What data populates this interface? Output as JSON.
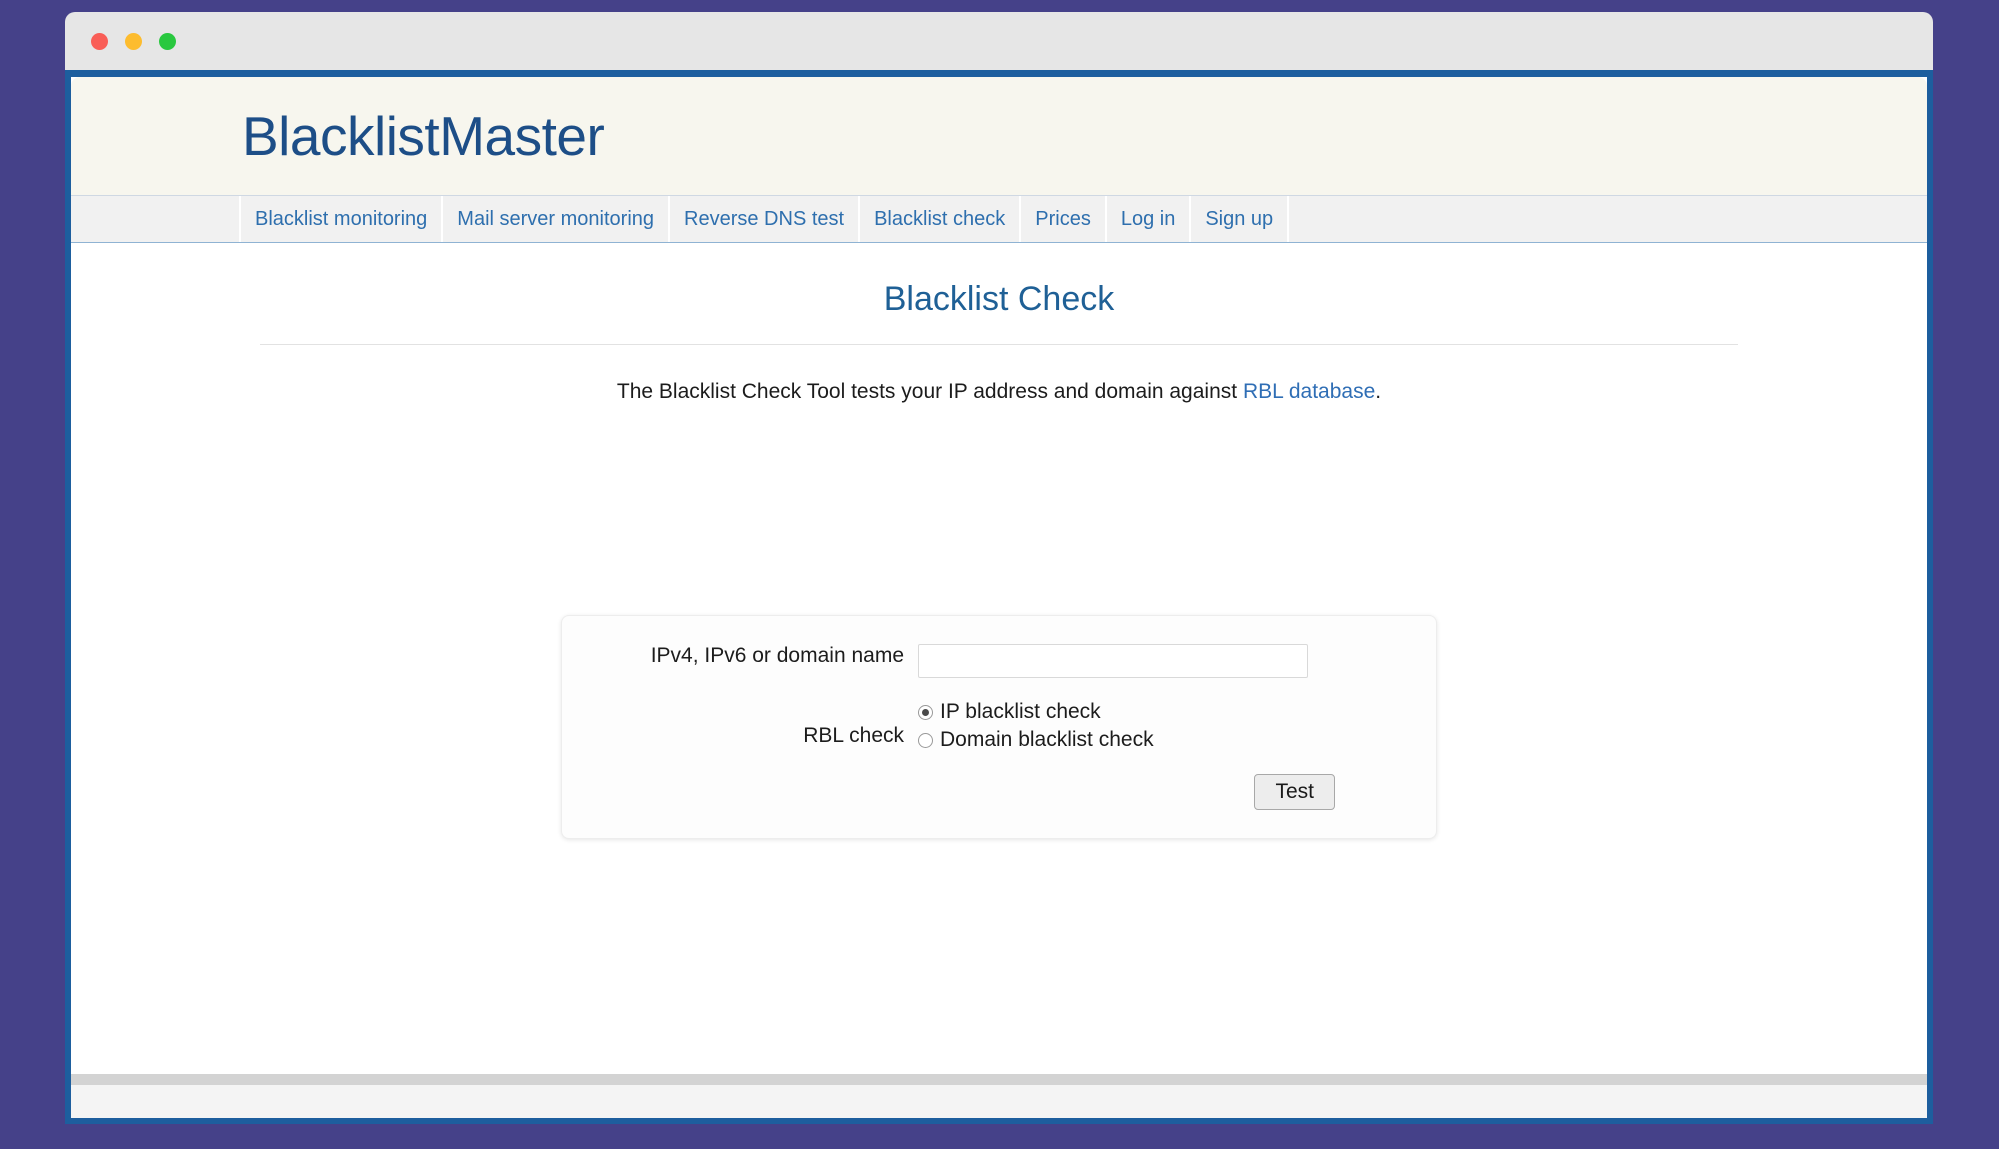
{
  "browser": {
    "traffic_lights": [
      {
        "name": "close",
        "color": "#f95e57"
      },
      {
        "name": "minimize",
        "color": "#fdbc2e"
      },
      {
        "name": "maximize",
        "color": "#29c83f"
      }
    ]
  },
  "site": {
    "logo": "BlacklistMaster",
    "nav": [
      {
        "label": "Blacklist monitoring"
      },
      {
        "label": "Mail server monitoring"
      },
      {
        "label": "Reverse DNS test"
      },
      {
        "label": "Blacklist check"
      },
      {
        "label": "Prices"
      },
      {
        "label": "Log in"
      },
      {
        "label": "Sign up"
      }
    ]
  },
  "main": {
    "title": "Blacklist Check",
    "lead_prefix": "The Blacklist Check Tool tests your IP address and domain against ",
    "lead_link": "RBL database",
    "lead_suffix": ".",
    "form": {
      "input_label": "IPv4, IPv6 or domain name",
      "input_value": "",
      "input_placeholder": "",
      "radio_label": "RBL check",
      "options": [
        {
          "label": "IP blacklist check",
          "selected": true
        },
        {
          "label": "Domain blacklist check",
          "selected": false
        }
      ],
      "submit_label": "Test"
    }
  },
  "colors": {
    "desktop_background": "#454189",
    "browser_frame": "#1d5e9e",
    "titlebar": "#e6e6e6",
    "header_background": "#f7f6ee",
    "nav_background": "#f1f1f1",
    "logo_text": "#1d4e87",
    "title_text": "#1f6096",
    "link": "#2f6eb5"
  }
}
